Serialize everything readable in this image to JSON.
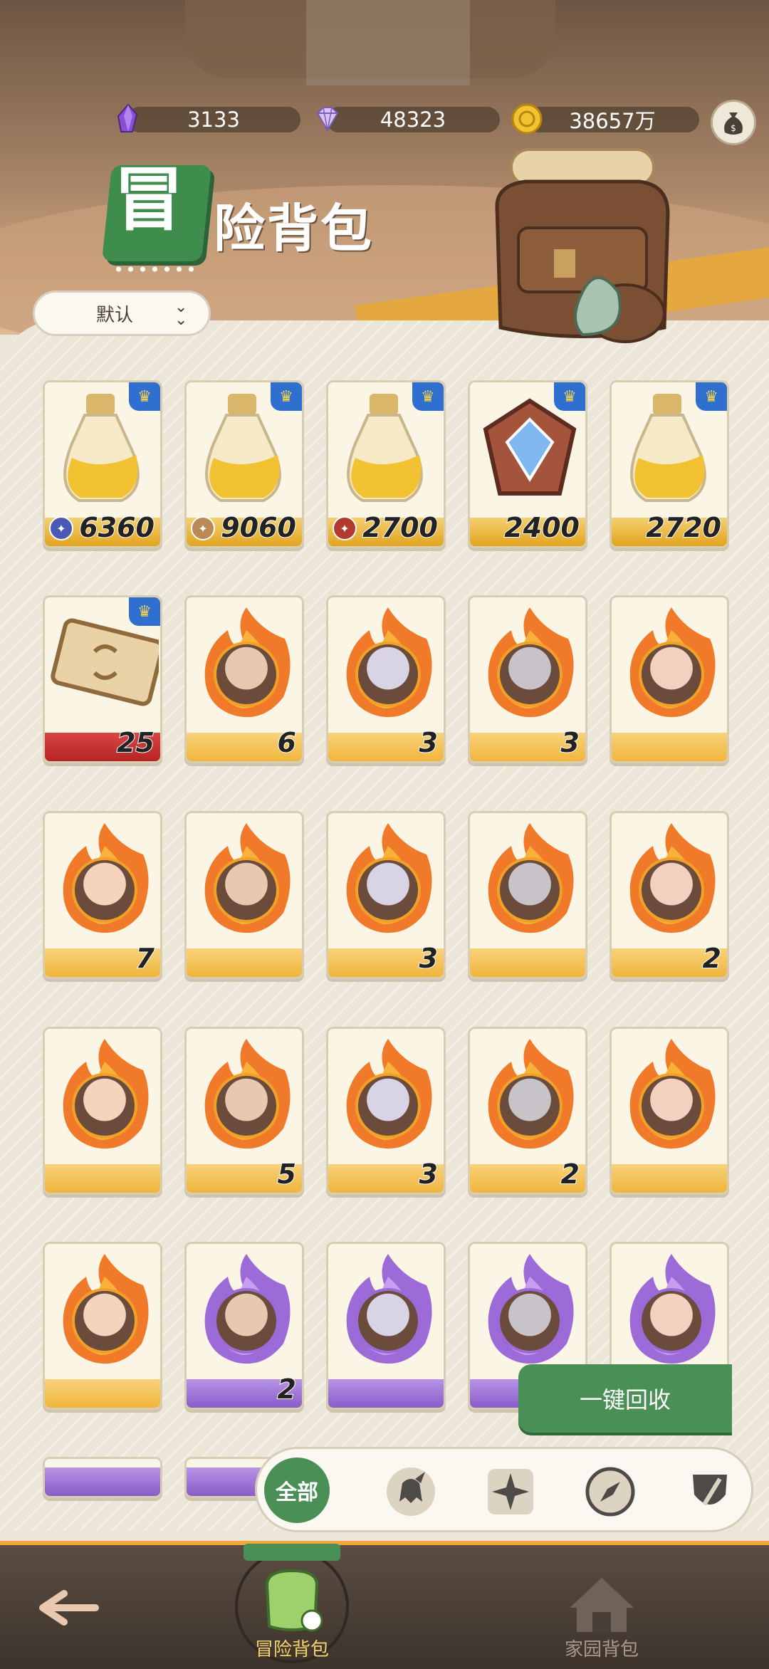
{
  "resources": [
    {
      "icon": "purple-crystal-icon",
      "value": "3133"
    },
    {
      "icon": "diamond-icon",
      "value": "48323"
    },
    {
      "icon": "gold-coin-icon",
      "value": "38657万"
    }
  ],
  "money_bag_icon": "money-bag-icon",
  "title": {
    "first_char": "冒",
    "rest": "险背包"
  },
  "sort": {
    "label": "默认"
  },
  "items": [
    {
      "type": "potion",
      "qty": "6360",
      "stat_icon": "swords-icon",
      "stat_color": "#4a59b4"
    },
    {
      "type": "potion",
      "qty": "9060",
      "stat_icon": "shield-icon",
      "stat_color": "#b98a55"
    },
    {
      "type": "potion",
      "qty": "2700",
      "stat_icon": "heart-icon",
      "stat_color": "#b33a30"
    },
    {
      "type": "gem-shield",
      "qty": "2400"
    },
    {
      "type": "potion",
      "qty": "2720"
    },
    {
      "type": "ticket",
      "qty": "25"
    },
    {
      "type": "hero-fire",
      "qty": "6"
    },
    {
      "type": "hero-fire",
      "qty": "3"
    },
    {
      "type": "hero-fire",
      "qty": "3"
    },
    {
      "type": "hero-fire",
      "qty": ""
    },
    {
      "type": "hero-fire",
      "qty": "7"
    },
    {
      "type": "hero-fire",
      "qty": ""
    },
    {
      "type": "hero-fire",
      "qty": "3"
    },
    {
      "type": "hero-fire",
      "qty": ""
    },
    {
      "type": "hero-fire",
      "qty": "2"
    },
    {
      "type": "hero-fire",
      "qty": ""
    },
    {
      "type": "hero-fire",
      "qty": "5"
    },
    {
      "type": "hero-fire",
      "qty": "3"
    },
    {
      "type": "hero-fire",
      "qty": "2"
    },
    {
      "type": "hero-fire",
      "qty": ""
    },
    {
      "type": "hero-fire",
      "qty": ""
    },
    {
      "type": "hero-purple",
      "qty": "2"
    },
    {
      "type": "hero-purple",
      "qty": ""
    },
    {
      "type": "hero-purple",
      "qty": ""
    },
    {
      "type": "hero-purple",
      "qty": ""
    },
    {
      "type": "hero-purple",
      "qty": ""
    },
    {
      "type": "hero-purple",
      "qty": ""
    }
  ],
  "recycle_button": "一键回收",
  "filters": {
    "all_label": "全部",
    "icons": [
      "warrior-helmet-icon",
      "star-compass-icon",
      "compass-icon",
      "sword-shield-icon"
    ]
  },
  "nav": {
    "back_icon": "back-arrow-icon",
    "adventure_label": "冒险背包",
    "home_label": "家园背包"
  },
  "colors": {
    "accent_green": "#4a8f55",
    "orange": "#f3a83d",
    "purple": "#8a5cc8"
  }
}
